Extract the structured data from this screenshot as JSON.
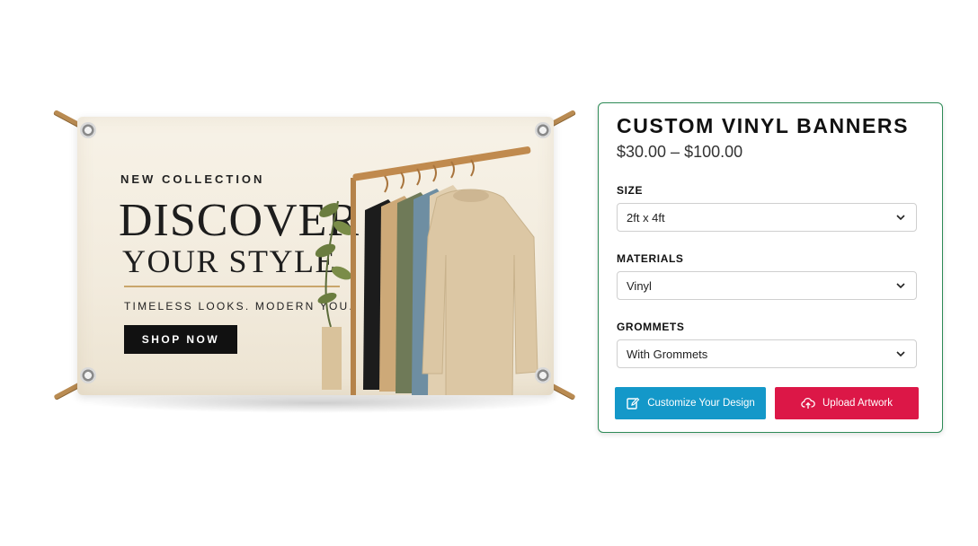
{
  "banner": {
    "subtitle": "NEW COLLECTION",
    "headline_line1": "DISCOVER",
    "headline_line2": "YOUR STYLE",
    "tagline": "TIMELESS LOOKS. MODERN YOU.",
    "cta_label": "SHOP NOW"
  },
  "product": {
    "title": "CUSTOM VINYL BANNERS",
    "price_range": "$30.00 – $100.00",
    "options": [
      {
        "label": "SIZE",
        "selected": "2ft x 4ft"
      },
      {
        "label": "MATERIALS",
        "selected": "Vinyl"
      },
      {
        "label": "GROMMETS",
        "selected": "With Grommets"
      }
    ],
    "buttons": {
      "customize": {
        "label": "Customize Your Design",
        "icon": "edit-icon",
        "color": "#1498c9"
      },
      "upload": {
        "label": "Upload Artwork",
        "icon": "cloud-upload-icon",
        "color": "#dc1747"
      }
    },
    "border_color": "#2e8b57"
  }
}
